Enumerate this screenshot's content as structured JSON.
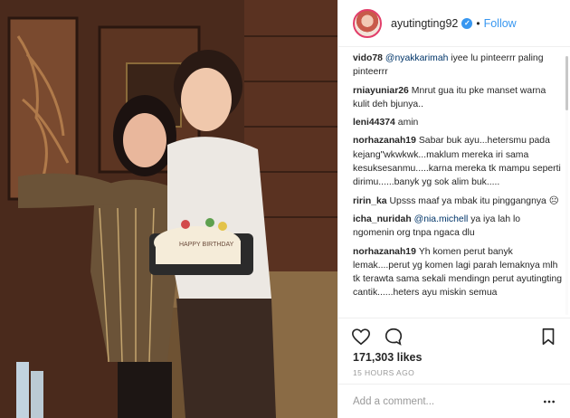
{
  "post": {
    "username": "ayutingting92",
    "verified_label": "✓",
    "separator": "•",
    "follow_label": "Follow",
    "likes": "171,303 likes",
    "time": "15 HOURS AGO",
    "add_comment_placeholder": "Add a comment..."
  },
  "photo": {
    "cake_text": "HAPPY BIRTHDAY"
  },
  "comments": [
    {
      "user": "vido78",
      "mention": "@nyakkarimah",
      "text": " iyee lu pinteerrr paling pinteerrr"
    },
    {
      "user": "rniayuniar26",
      "mention": "",
      "text": "Mnrut gua itu pke manset warna kulit deh bjunya.."
    },
    {
      "user": "leni44374",
      "mention": "",
      "text": "amin"
    },
    {
      "user": "norhazanah19",
      "mention": "",
      "text": "Sabar buk ayu...hetersmu pada kejang\"wkwkwk...maklum mereka iri sama kesuksesanmu.....karna mereka tk mampu seperti dirimu......banyk yg sok alim buk....."
    },
    {
      "user": "ririn_ka",
      "mention": "",
      "text": "Upsss maaf ya mbak itu pinggangnya ☹"
    },
    {
      "user": "icha_nuridah",
      "mention": "@nia.michell",
      "text": " ya iya lah lo ngomenin org tnpa ngaca dlu"
    },
    {
      "user": "norhazanah19",
      "mention": "",
      "text": "Yh komen perut banyk lemak....perut yg komen lagi parah lemaknya mlh tk terawta sama sekali mendingn perut ayutingting cantik......heters ayu miskin semua"
    }
  ],
  "icons": {
    "like": "heart-outline-icon",
    "comment": "speech-bubble-icon",
    "save": "bookmark-icon",
    "more": "more-dots-icon",
    "verified": "verified-badge-icon"
  },
  "colors": {
    "accent": "#3897f0",
    "text": "#262626",
    "muted": "#999999",
    "border": "#efefef"
  }
}
